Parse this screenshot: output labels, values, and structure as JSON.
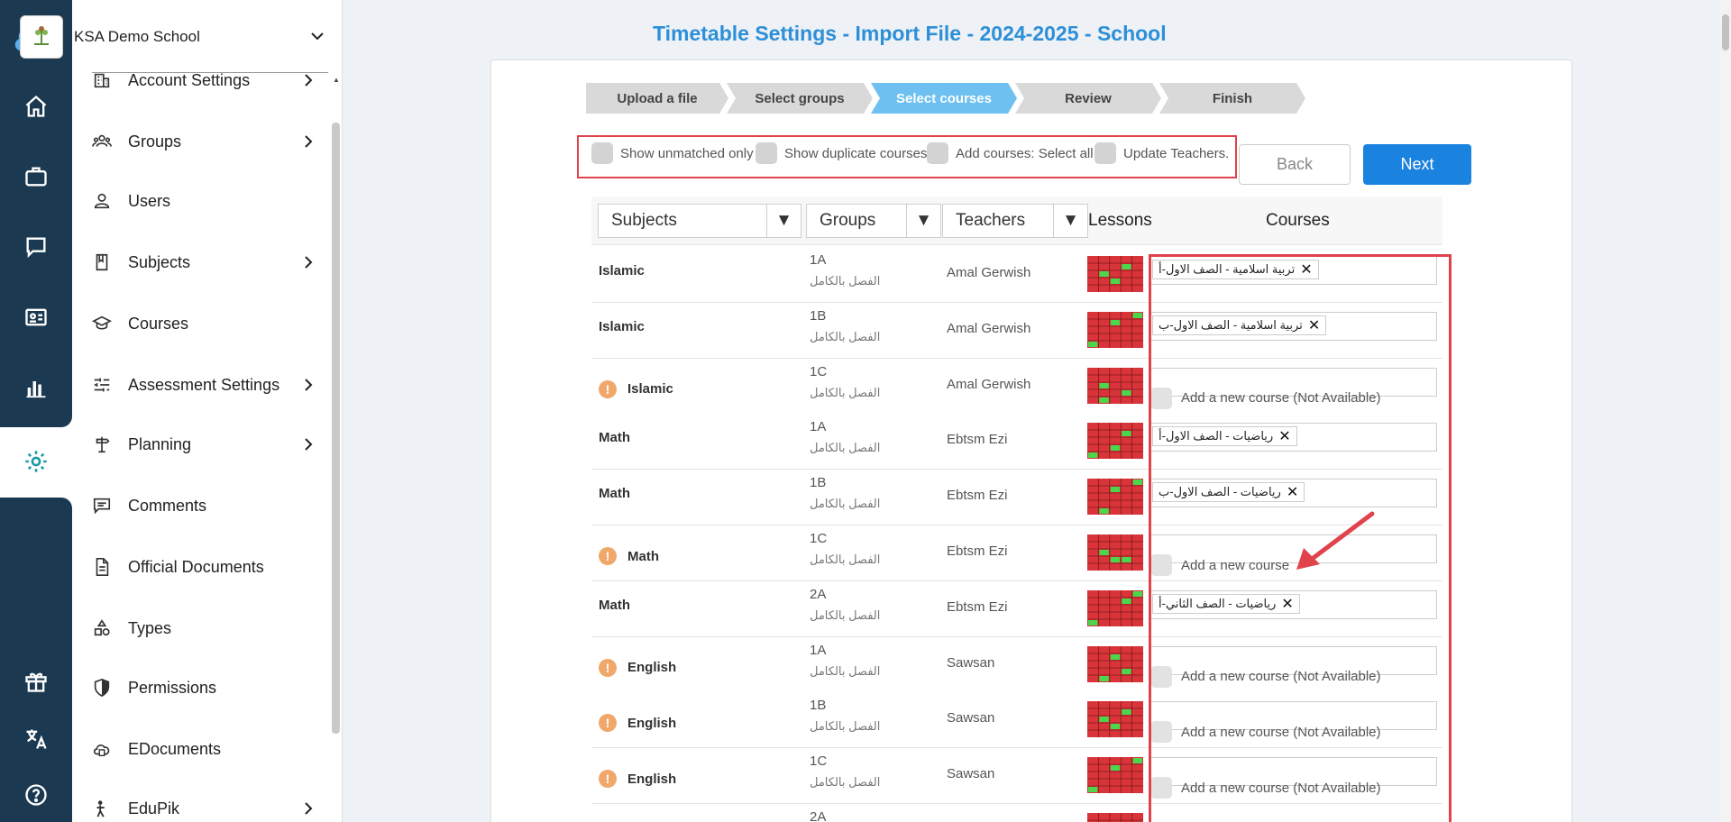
{
  "school": {
    "name": "KSA Demo School"
  },
  "rail": {
    "icons": [
      "home-icon",
      "briefcase-icon",
      "chat-icon",
      "id-card-icon",
      "bar-chart-icon",
      "gear-icon",
      "gift-icon",
      "translate-icon",
      "help-icon"
    ]
  },
  "sidebar": {
    "items": [
      {
        "label": "Account Settings",
        "icon": "building-icon",
        "chev": true
      },
      {
        "label": "Groups",
        "icon": "groups-icon",
        "chev": true
      },
      {
        "label": "Users",
        "icon": "user-icon",
        "chev": false
      },
      {
        "label": "Subjects",
        "icon": "book-icon",
        "chev": true
      },
      {
        "label": "Courses",
        "icon": "graduation-cap-icon",
        "chev": false
      },
      {
        "label": "Assessment Settings",
        "icon": "sliders-icon",
        "chev": true
      },
      {
        "label": "Planning",
        "icon": "signpost-icon",
        "chev": true
      },
      {
        "label": "Comments",
        "icon": "comment-icon",
        "chev": false
      },
      {
        "label": "Official Documents",
        "icon": "document-icon",
        "chev": false
      },
      {
        "label": "Types",
        "icon": "shapes-icon",
        "chev": false
      },
      {
        "label": "Permissions",
        "icon": "shield-icon",
        "chev": false
      },
      {
        "label": "EDocuments",
        "icon": "cloud-doc-icon",
        "chev": false
      },
      {
        "label": "EduPik",
        "icon": "person-icon",
        "chev": true
      }
    ]
  },
  "page": {
    "title": "Timetable Settings - Import File - 2024-2025 - School"
  },
  "wizard": {
    "steps": [
      "Upload a file",
      "Select groups",
      "Select courses",
      "Review",
      "Finish"
    ],
    "active": 2
  },
  "options": {
    "unmatched": "Show unmatched only",
    "duplicate": "Show duplicate courses",
    "select_all": "Add courses: Select all",
    "teachers": "Update Teachers."
  },
  "buttons": {
    "back": "Back",
    "next": "Next"
  },
  "table": {
    "filters": {
      "subjects": "Subjects",
      "groups": "Groups",
      "teachers": "Teachers"
    },
    "headers": {
      "lessons": "Lessons",
      "courses": "Courses"
    },
    "full_class": "الفصل بالكامل",
    "add_new": "Add a new course",
    "add_new_na": "Add a new course (Not Available)",
    "rows": [
      {
        "subject": "Islamic",
        "warn": false,
        "group": "1A",
        "teacher": "Amal Gerwish",
        "course": "تربية اسلامية - الصف الاول-أ"
      },
      {
        "subject": "Islamic",
        "warn": false,
        "group": "1B",
        "teacher": "Amal Gerwish",
        "course": "تربية اسلامية - الصف الاول-ب"
      },
      {
        "subject": "Islamic",
        "warn": true,
        "group": "1C",
        "teacher": "Amal Gerwish",
        "course": "",
        "add": "na"
      },
      {
        "subject": "Math",
        "warn": false,
        "group": "1A",
        "teacher": "Ebtsm Ezi",
        "course": "رياضيات - الصف الاول-أ"
      },
      {
        "subject": "Math",
        "warn": false,
        "group": "1B",
        "teacher": "Ebtsm Ezi",
        "course": "رياضيات - الصف الاول-ب"
      },
      {
        "subject": "Math",
        "warn": true,
        "group": "1C",
        "teacher": "Ebtsm Ezi",
        "course": "",
        "add": "new"
      },
      {
        "subject": "Math",
        "warn": false,
        "group": "2A",
        "teacher": "Ebtsm Ezi",
        "course": "رياضيات - الصف الثاني-أ"
      },
      {
        "subject": "English",
        "warn": true,
        "group": "1A",
        "teacher": "Sawsan",
        "course": "",
        "add": "na"
      },
      {
        "subject": "English",
        "warn": true,
        "group": "1B",
        "teacher": "Sawsan",
        "course": "",
        "add": "na"
      },
      {
        "subject": "English",
        "warn": true,
        "group": "1C",
        "teacher": "Sawsan",
        "course": "",
        "add": "na"
      },
      {
        "subject": "",
        "warn": false,
        "group": "2A",
        "teacher": "",
        "course": ""
      }
    ]
  },
  "colors": {
    "accent": "#2c8fd8",
    "primary": "#1a82df",
    "highlight": "#e0434b",
    "step_active": "#6dc0ef",
    "cell_red": "#d9343a",
    "cell_green": "#4cd64c"
  }
}
